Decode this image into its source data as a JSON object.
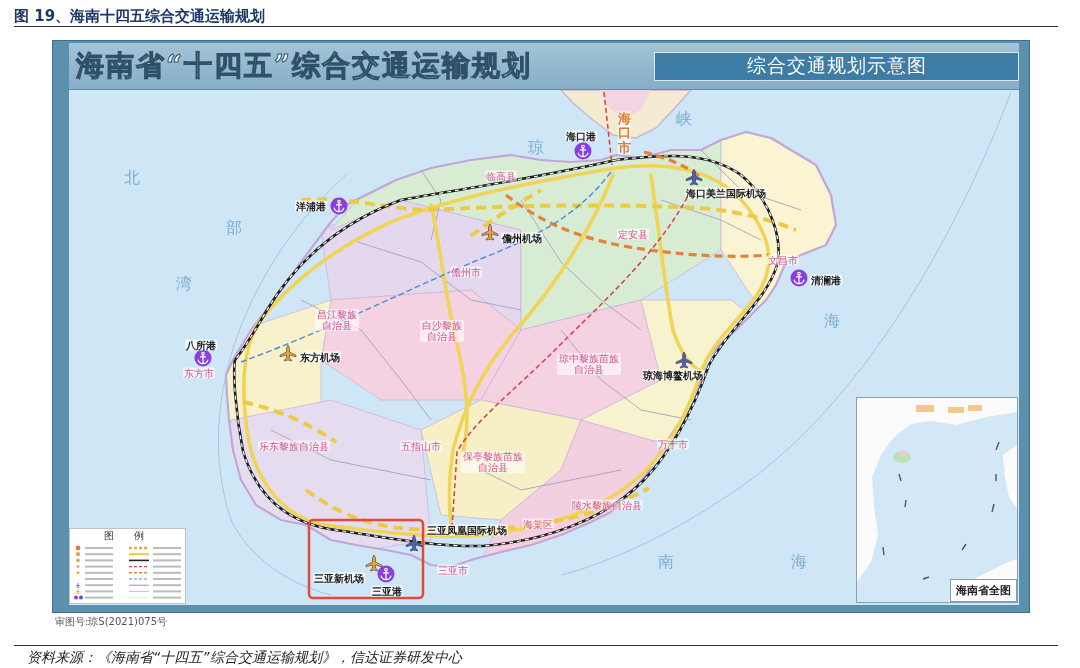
{
  "figure_title": "图 19、海南十四五综合交通运输规划",
  "map": {
    "title": "海南省“十四五”综合交通运输规划",
    "subtitle": "综合交通规划示意图",
    "sea_labels": [
      "北",
      "部",
      "湾",
      "琼",
      "峡",
      "海",
      "南",
      "海"
    ],
    "place_labels": [
      {
        "kind": "capital",
        "name": "海口市"
      },
      {
        "kind": "county",
        "name": "临高县"
      },
      {
        "kind": "county",
        "name": "儋州市"
      },
      {
        "kind": "county",
        "name": "定安县"
      },
      {
        "kind": "county",
        "name": "文昌市"
      },
      {
        "kind": "county",
        "name": "东方市"
      },
      {
        "kind": "county",
        "name": "昌江黎族自治县"
      },
      {
        "kind": "county",
        "name": "白沙黎族自治县"
      },
      {
        "kind": "county",
        "name": "琼中黎族苗族自治县"
      },
      {
        "kind": "county",
        "name": "乐东黎族自治县"
      },
      {
        "kind": "county",
        "name": "五指山市"
      },
      {
        "kind": "county",
        "name": "保亭黎族苗族自治县"
      },
      {
        "kind": "county",
        "name": "万宁市"
      },
      {
        "kind": "county",
        "name": "陵水黎族自治县"
      },
      {
        "kind": "county",
        "name": "海棠区"
      },
      {
        "kind": "county",
        "name": "三亚市"
      }
    ],
    "ports": [
      {
        "name": "海口港"
      },
      {
        "name": "洋浦港"
      },
      {
        "name": "八所港"
      },
      {
        "name": "清澜港"
      },
      {
        "name": "三亚港"
      }
    ],
    "airports": [
      {
        "name": "海口美兰国际机场",
        "color": "#4f5fb8"
      },
      {
        "name": "儋州机场",
        "color": "#e8a33c"
      },
      {
        "name": "东方机场",
        "color": "#e8a33c"
      },
      {
        "name": "琼海博鳌机场",
        "color": "#4f5fb8"
      },
      {
        "name": "三亚凤凰国际机场",
        "color": "#4f5fb8"
      },
      {
        "name": "三亚新机场",
        "color": "#e8a33c"
      }
    ],
    "legend": {
      "title": "图 例"
    },
    "inset": {
      "title": "海南省全图"
    },
    "approval_number": "审图号:琼S(2021)075号"
  },
  "source_note": "资料来源：《海南省“十四五”综合交通运输规划》，信达证券研发中心"
}
